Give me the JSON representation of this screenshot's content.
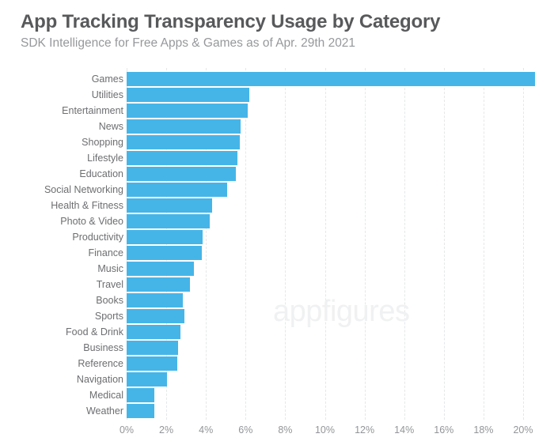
{
  "header": {
    "title": "App Tracking Transparency Usage by Category",
    "subtitle": "SDK Intelligence for Free Apps & Games as of Apr. 29th 2021"
  },
  "watermark": {
    "text": "appfigures"
  },
  "colors": {
    "bar": "#45b5e8",
    "title": "#58595b",
    "subtitle": "#96989b",
    "category_label": "#6d6e71",
    "tick_label": "#939598",
    "gridline": "#e6e7e8",
    "background": "#ffffff",
    "watermark": "#f0f1f2"
  },
  "chart_data": {
    "type": "bar",
    "orientation": "horizontal",
    "title": "App Tracking Transparency Usage by Category",
    "subtitle": "SDK Intelligence for Free Apps & Games as of Apr. 29th 2021",
    "xlabel": "",
    "ylabel": "",
    "xlim": [
      0,
      20.9
    ],
    "xticks": [
      0,
      2,
      4,
      6,
      8,
      10,
      12,
      14,
      16,
      18,
      20
    ],
    "xtick_labels": [
      "0%",
      "2%",
      "4%",
      "6%",
      "8%",
      "10%",
      "12%",
      "14%",
      "16%",
      "18%",
      "20%"
    ],
    "grid": true,
    "grid_axis": "x",
    "grid_style": "dashed",
    "legend": false,
    "unit": "%",
    "categories": [
      "Games",
      "Utilities",
      "Entertainment",
      "News",
      "Shopping",
      "Lifestyle",
      "Education",
      "Social Networking",
      "Health & Fitness",
      "Photo & Video",
      "Productivity",
      "Finance",
      "Music",
      "Travel",
      "Books",
      "Sports",
      "Food & Drink",
      "Business",
      "Reference",
      "Navigation",
      "Medical",
      "Weather"
    ],
    "values": [
      20.6,
      6.2,
      6.1,
      5.75,
      5.7,
      5.6,
      5.5,
      5.05,
      4.3,
      4.2,
      3.85,
      3.8,
      3.4,
      3.2,
      2.85,
      2.9,
      2.7,
      2.6,
      2.55,
      2.05,
      1.4,
      1.4
    ]
  }
}
